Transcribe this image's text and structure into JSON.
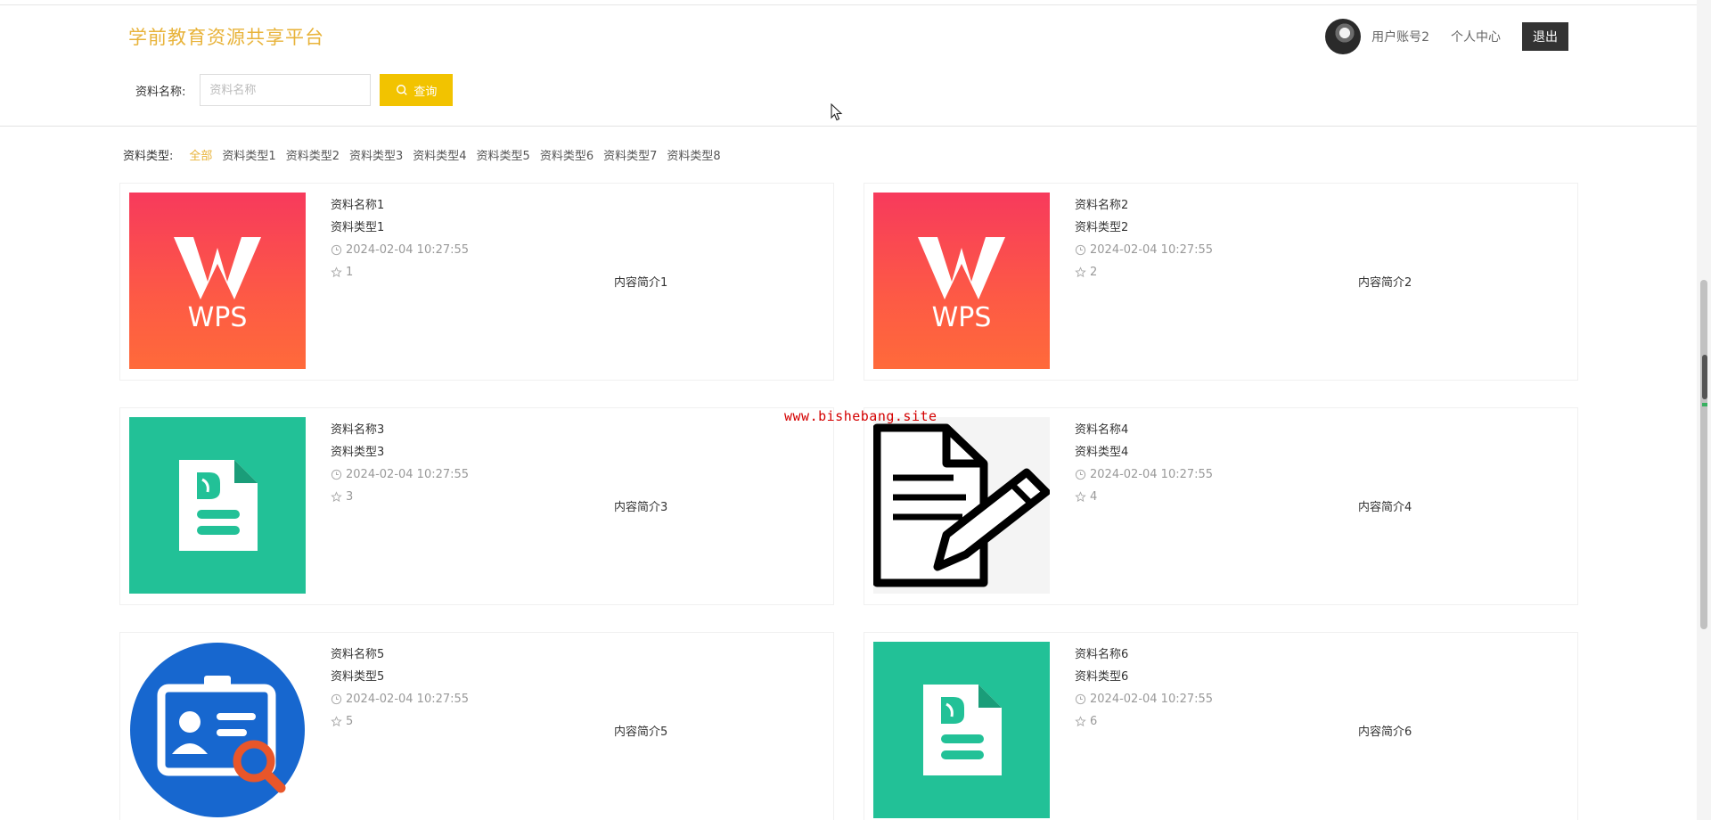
{
  "header": {
    "site_title": "学前教育资源共享平台",
    "username": "用户账号2",
    "profile_link": "个人中心",
    "logout_label": "退出"
  },
  "search": {
    "label": "资料名称:",
    "placeholder": "资料名称",
    "button_label": "查询"
  },
  "filters": {
    "label": "资料类型:",
    "items": [
      "全部",
      "资料类型1",
      "资料类型2",
      "资料类型3",
      "资料类型4",
      "资料类型5",
      "资料类型6",
      "资料类型7",
      "资料类型8"
    ],
    "active_index": 0
  },
  "cards": [
    {
      "name": "资料名称1",
      "type": "资料类型1",
      "time": "2024-02-04 10:27:55",
      "stars": "1",
      "summary": "内容简介1",
      "thumb": "wps"
    },
    {
      "name": "资料名称2",
      "type": "资料类型2",
      "time": "2024-02-04 10:27:55",
      "stars": "2",
      "summary": "内容简介2",
      "thumb": "wps"
    },
    {
      "name": "资料名称3",
      "type": "资料类型3",
      "time": "2024-02-04 10:27:55",
      "stars": "3",
      "summary": "内容简介3",
      "thumb": "doc"
    },
    {
      "name": "资料名称4",
      "type": "资料类型4",
      "time": "2024-02-04 10:27:55",
      "stars": "4",
      "summary": "内容简介4",
      "thumb": "edit"
    },
    {
      "name": "资料名称5",
      "type": "资料类型5",
      "time": "2024-02-04 10:27:55",
      "stars": "5",
      "summary": "内容简介5",
      "thumb": "id"
    },
    {
      "name": "资料名称6",
      "type": "资料类型6",
      "time": "2024-02-04 10:27:55",
      "stars": "6",
      "summary": "内容简介6",
      "thumb": "doc"
    }
  ],
  "watermark": "www.bishebang.site",
  "colors": {
    "brand": "#e8b33a",
    "search_button": "#f2c300",
    "logout_button": "#333333",
    "doc_thumb": "#22c197"
  }
}
